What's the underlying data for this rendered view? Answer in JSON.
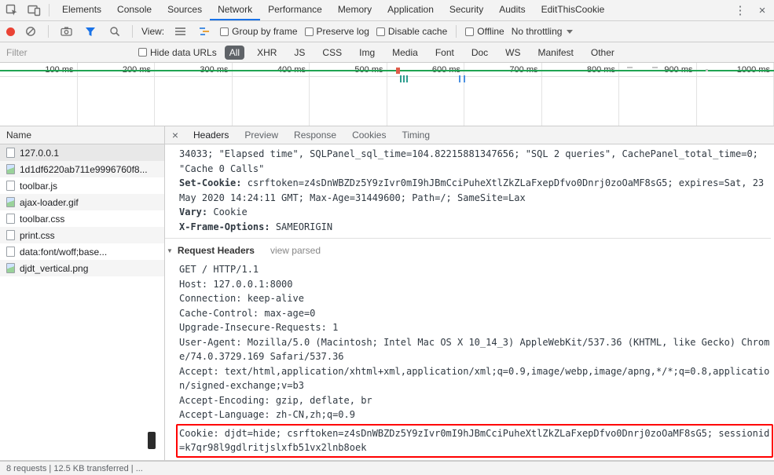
{
  "colors": {
    "accent_blue": "#1a73e8",
    "record_red": "#ea4335",
    "timeline_green": "#21a453",
    "highlight_red": "#ff0000"
  },
  "icons": {
    "more": "⋮",
    "close": "×",
    "panel_close": "×",
    "disclosure": "▼"
  },
  "tabbar": {
    "tabs": [
      "Elements",
      "Console",
      "Sources",
      "Network",
      "Performance",
      "Memory",
      "Application",
      "Security",
      "Audits",
      "EditThisCookie"
    ],
    "active": "Network"
  },
  "toolbar": {
    "view_label": "View:",
    "group_by_frame": "Group by frame",
    "preserve_log": "Preserve log",
    "disable_cache": "Disable cache",
    "offline": "Offline",
    "throttling": "No throttling"
  },
  "filterbar": {
    "filter_placeholder": "Filter",
    "hide_data_urls": "Hide data URLs",
    "types": [
      "All",
      "XHR",
      "JS",
      "CSS",
      "Img",
      "Media",
      "Font",
      "Doc",
      "WS",
      "Manifest",
      "Other"
    ],
    "selected_type": "All"
  },
  "overview": {
    "ticks": [
      "100 ms",
      "200 ms",
      "300 ms",
      "400 ms",
      "500 ms",
      "600 ms",
      "700 ms",
      "800 ms",
      "900 ms",
      "1000 ms"
    ]
  },
  "requests": {
    "name_header": "Name",
    "rows": [
      {
        "name": "127.0.0.1",
        "type": "doc"
      },
      {
        "name": "1d1df6220ab711e9996760f8...",
        "type": "img"
      },
      {
        "name": "toolbar.js",
        "type": "js"
      },
      {
        "name": "ajax-loader.gif",
        "type": "img"
      },
      {
        "name": "toolbar.css",
        "type": "css"
      },
      {
        "name": "print.css",
        "type": "css"
      },
      {
        "name": "data:font/woff;base...",
        "type": "font"
      },
      {
        "name": "djdt_vertical.png",
        "type": "img"
      }
    ],
    "selected": "127.0.0.1"
  },
  "details": {
    "tabs": [
      "Headers",
      "Preview",
      "Response",
      "Cookies",
      "Timing"
    ],
    "active": "Headers",
    "response_tail": "34033; \"Elapsed time\", SQLPanel_sql_time=104.82215881347656; \"SQL 2 queries\", CachePanel_total_time=0; \"Cache 0 Calls\"",
    "headers": [
      {
        "name": "Set-Cookie:",
        "value": "csrftoken=z4sDnWBZDz5Y9zIvr0mI9hJBmCciPuheXtlZkZLaFxepDfvo0Dnrj0zoOaMF8sG5; expires=Sat, 23 May 2020 14:24:11 GMT; Max-Age=31449600; Path=/; SameSite=Lax"
      },
      {
        "name": "Vary:",
        "value": "Cookie"
      },
      {
        "name": "X-Frame-Options:",
        "value": "SAMEORIGIN"
      }
    ],
    "request_headers_title": "Request Headers",
    "view_parsed": "view parsed",
    "raw_request": [
      "GET / HTTP/1.1",
      "Host: 127.0.0.1:8000",
      "Connection: keep-alive",
      "Cache-Control: max-age=0",
      "Upgrade-Insecure-Requests: 1",
      "User-Agent: Mozilla/5.0 (Macintosh; Intel Mac OS X 10_14_3) AppleWebKit/537.36 (KHTML, like Gecko) Chrome/74.0.3729.169 Safari/537.36",
      "Accept: text/html,application/xhtml+xml,application/xml;q=0.9,image/webp,image/apng,*/*;q=0.8,application/signed-exchange;v=b3",
      "Accept-Encoding: gzip, deflate, br",
      "Accept-Language: zh-CN,zh;q=0.9"
    ],
    "cookie_header": "Cookie: djdt=hide; csrftoken=z4sDnWBZDz5Y9zIvr0mI9hJBmCciPuheXtlZkZLaFxepDfvo0Dnrj0zoOaMF8sG5; sessionid=k7qr98l9gdlritjslxfb51vx2lnb8oek"
  },
  "statusbar": {
    "summary": "8 requests | 12.5 KB transferred | ..."
  }
}
